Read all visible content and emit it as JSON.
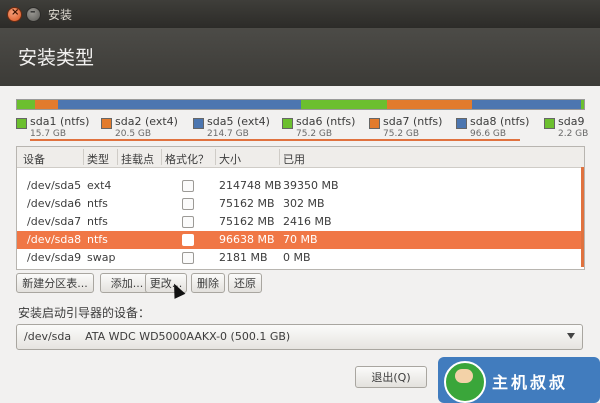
{
  "window": {
    "title": "安装"
  },
  "page": {
    "title": "安装类型"
  },
  "partition_bar": {
    "segments": [
      {
        "color": "#6cbf2f",
        "weight": 15.7
      },
      {
        "color": "#e27b2d",
        "weight": 20.5
      },
      {
        "color": "#4c76b0",
        "weight": 214.7
      },
      {
        "color": "#6cbf2f",
        "weight": 75.2
      },
      {
        "color": "#e27b2d",
        "weight": 75.2
      },
      {
        "color": "#4c76b0",
        "weight": 96.6
      },
      {
        "color": "#6cbf2f",
        "weight": 2.2
      }
    ]
  },
  "legend": [
    {
      "name": "sda1 (ntfs)",
      "size": "15.7 GB",
      "color": "#6cbf2f"
    },
    {
      "name": "sda2 (ext4)",
      "size": "20.5 GB",
      "color": "#e27b2d"
    },
    {
      "name": "sda5 (ext4)",
      "size": "214.7 GB",
      "color": "#4c76b0"
    },
    {
      "name": "sda6 (ntfs)",
      "size": "75.2 GB",
      "color": "#6cbf2f"
    },
    {
      "name": "sda7 (ntfs)",
      "size": "75.2 GB",
      "color": "#e27b2d"
    },
    {
      "name": "sda8 (ntfs)",
      "size": "96.6 GB",
      "color": "#4c76b0"
    },
    {
      "name": "sda9",
      "size": "2.2 GB",
      "color": "#6cbf2f"
    }
  ],
  "table": {
    "headers": [
      "设备",
      "类型",
      "挂载点",
      "格式化？",
      "大小",
      "已用"
    ],
    "rows": [
      {
        "device": "/dev/sda5",
        "type": "ext4",
        "mount": "",
        "size": "214748 MB",
        "used": "39350 MB",
        "selected": false
      },
      {
        "device": "/dev/sda6",
        "type": "ntfs",
        "mount": "",
        "size": "75162 MB",
        "used": "302 MB",
        "selected": false
      },
      {
        "device": "/dev/sda7",
        "type": "ntfs",
        "mount": "",
        "size": "75162 MB",
        "used": "2416 MB",
        "selected": false
      },
      {
        "device": "/dev/sda8",
        "type": "ntfs",
        "mount": "",
        "size": "96638 MB",
        "used": "70 MB",
        "selected": true
      },
      {
        "device": "/dev/sda9",
        "type": "swap",
        "mount": "",
        "size": "2181 MB",
        "used": "0 MB",
        "selected": false
      }
    ]
  },
  "buttons": {
    "new_table": "新建分区表...",
    "add": "添加...",
    "change": "更改...",
    "delete": "删除",
    "revert": "还原"
  },
  "boot": {
    "label": "安装启动引导器的设备：",
    "device": "/dev/sda    ATA WDC WD5000AAKX-0 (500.1 GB)"
  },
  "quit_button": "退出(Q)",
  "watermark": {
    "text": "主机叔叔"
  }
}
